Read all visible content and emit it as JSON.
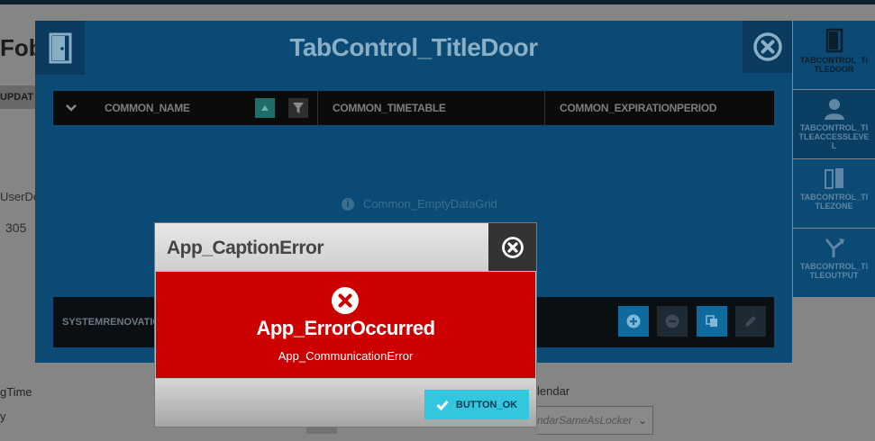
{
  "background": {
    "fob_label": "Fob",
    "update_label": "UPDAT",
    "user_label": "UserDe",
    "number_305": "305",
    "time_label": "gTime",
    "y_label": "y",
    "calendar_label": "lendar",
    "select_placeholder": "ndarSameAsLocker"
  },
  "panel": {
    "title": "TabControl_TitleDoor",
    "grid": {
      "columns": [
        "COMMON_NAME",
        "COMMON_TIMETABLE",
        "COMMON_EXPIRATIONPERIOD"
      ],
      "empty_message": "Common_EmptyDataGrid"
    },
    "footer_label": "SYSTEMRENOVATION"
  },
  "side_tabs": [
    {
      "label": "TABCONTROL_TITLEDOOR",
      "icon": "door-icon"
    },
    {
      "label": "TABCONTROL_TITLEACCESSLEVEL",
      "icon": "user-icon"
    },
    {
      "label": "TABCONTROL_TITLEZONE",
      "icon": "zone-icon"
    },
    {
      "label": "TABCONTROL_TITLEOUTPUT",
      "icon": "output-icon"
    }
  ],
  "dialog": {
    "caption": "App_CaptionError",
    "title": "App_ErrorOccurred",
    "message": "App_CommunicationError",
    "ok_label": "BUTTON_OK"
  },
  "colors": {
    "panel": "#0b4a75",
    "error": "#cc0000",
    "ok_button": "#33c7df",
    "sort_button": "#1f6d68"
  }
}
